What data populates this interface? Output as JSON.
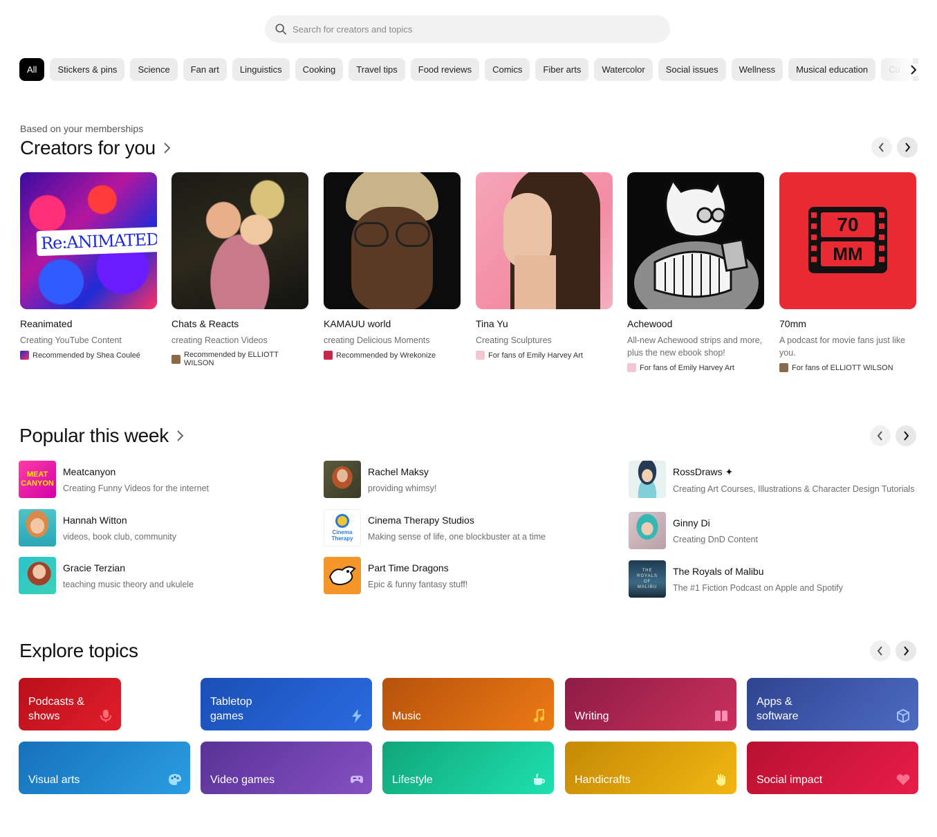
{
  "search": {
    "placeholder": "Search for creators and topics"
  },
  "chips": [
    "All",
    "Stickers & pins",
    "Science",
    "Fan art",
    "Linguistics",
    "Cooking",
    "Travel tips",
    "Food reviews",
    "Comics",
    "Fiber arts",
    "Watercolor",
    "Social issues",
    "Wellness",
    "Musical education",
    "Cu"
  ],
  "creators_section": {
    "eyebrow": "Based on your memberships",
    "title": "Creators for you",
    "cards": [
      {
        "name": "Reanimated",
        "desc": "Creating YouTube Content",
        "rec": "Recommended by Shea Couleé",
        "thumb_text": "Re:ANIMATED"
      },
      {
        "name": "Chats & Reacts",
        "desc": "creating Reaction Videos",
        "rec": "Recommended by ELLIOTT WILSON"
      },
      {
        "name": "KAMAUU world",
        "desc": "creating Delicious Moments",
        "rec": "Recommended by Wrekonize"
      },
      {
        "name": "Tina Yu",
        "desc": "Creating Sculptures",
        "rec": "For fans of Emily Harvey Art"
      },
      {
        "name": "Achewood",
        "desc": "All-new Achewood strips and more, plus the new ebook shop!",
        "rec": "For fans of Emily Harvey Art"
      },
      {
        "name": "70mm",
        "desc": "A podcast for movie fans just like you.",
        "rec": "For fans of ELLIOTT WILSON",
        "thumb_text_1": "70",
        "thumb_text_2": "MM"
      }
    ]
  },
  "popular_section": {
    "title": "Popular this week",
    "items": [
      {
        "name": "Meatcanyon",
        "desc": "Creating Funny Videos for the internet",
        "thumb_text_1": "MEAT",
        "thumb_text_2": "CANYON"
      },
      {
        "name": "Hannah Witton",
        "desc": "videos, book club, community"
      },
      {
        "name": "Gracie Terzian",
        "desc": "teaching music theory and ukulele"
      },
      {
        "name": "Rachel Maksy",
        "desc": "providing whimsy!"
      },
      {
        "name": "Cinema Therapy Studios",
        "desc": "Making sense of life, one blockbuster at a time",
        "thumb_text": "Cinema Therapy"
      },
      {
        "name": "Part Time Dragons",
        "desc": "Epic & funny fantasy stuff!"
      },
      {
        "name": "RossDraws ✦",
        "desc": "Creating Art Courses, Illustrations & Character Design Tutorials"
      },
      {
        "name": "Ginny Di",
        "desc": "Creating DnD Content"
      },
      {
        "name": "The Royals of Malibu",
        "desc": "The #1 Fiction Podcast on Apple and Spotify",
        "thumb_text": "THE ROYALS OF MALIBU"
      }
    ]
  },
  "topics_section": {
    "title": "Explore topics",
    "topics": [
      {
        "label": "Podcasts & shows",
        "icon": "microphone-icon"
      },
      {
        "label": "Tabletop games",
        "icon": "lightning-icon"
      },
      {
        "label": "Music",
        "icon": "music-note-icon"
      },
      {
        "label": "Writing",
        "icon": "book-icon"
      },
      {
        "label": "Apps & software",
        "icon": "cube-icon"
      },
      {
        "label": "Visual arts",
        "icon": "palette-icon"
      },
      {
        "label": "Video games",
        "icon": "gamepad-icon"
      },
      {
        "label": "Lifestyle",
        "icon": "teapot-icon"
      },
      {
        "label": "Handicrafts",
        "icon": "hand-icon"
      },
      {
        "label": "Social impact",
        "icon": "heart-icon"
      }
    ],
    "colors": [
      "#c8141f",
      "#1c56c4",
      "#e0660f",
      "#b0224f",
      "#3d57a8",
      "#1e86cf",
      "#6b3fa6",
      "#17bc8c",
      "#e3a80a",
      "#d0143c"
    ]
  }
}
